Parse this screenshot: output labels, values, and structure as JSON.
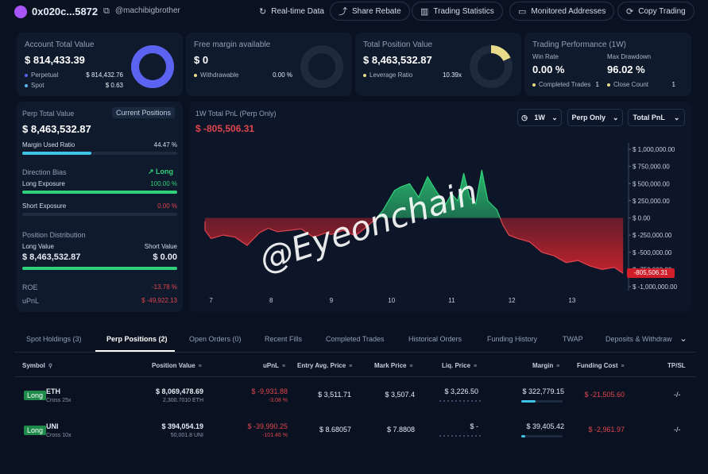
{
  "header": {
    "address": "0x020c...5872",
    "handle": "@machibigbrother",
    "buttons": [
      {
        "label": "Real-time Data",
        "icon": "refresh-icon"
      },
      {
        "label": "Share Rebate",
        "icon": "share-icon"
      },
      {
        "label": "Trading Statistics",
        "icon": "bar-chart-icon"
      },
      {
        "label": "Monitored Addresses",
        "icon": "monitor-icon"
      },
      {
        "label": "Copy Trading",
        "icon": "copy-trade-icon"
      }
    ]
  },
  "account": {
    "title": "Account Total Value",
    "value": "$ 814,433.39",
    "perpetual_label": "Perpetual",
    "perpetual_value": "$ 814,432.76",
    "spot_label": "Spot",
    "spot_value": "$ 0.63",
    "donut_fill": 0.999,
    "color": "#5b63f0"
  },
  "margin": {
    "title": "Free margin available",
    "value": "$ 0",
    "withdrawable_label": "Withdrawable",
    "withdrawable_value": "0.00 %"
  },
  "position": {
    "title": "Total Position Value",
    "value": "$ 8,463,532.87",
    "leverage_label": "Leverage Ratio",
    "leverage_value": "10.39x",
    "donut_fill": 0.18,
    "color": "#e8dc8a"
  },
  "performance": {
    "title": "Trading Performance (1W)",
    "win_rate_label": "Win Rate",
    "win_rate_value": "0.00 %",
    "drawdown_label": "Max Drawdown",
    "drawdown_value": "96.02 %",
    "completed_label": "Completed Trades",
    "completed_value": "1",
    "close_label": "Close Count",
    "close_value": "1"
  },
  "perp": {
    "title": "Perp Total Value",
    "current_positions": "Current Positions",
    "value": "$ 8,463,532.87",
    "margin_label": "Margin Used Ratio",
    "margin_value": "44.47 %",
    "margin_fill": 0.4447,
    "direction_label": "Direction Bias",
    "direction_value": "Long",
    "long_label": "Long Exposure",
    "long_value": "100.00 %",
    "long_fill": 1.0,
    "short_label": "Short Exposure",
    "short_value": "0.00 %",
    "short_fill": 0,
    "distribution_label": "Position Distribution",
    "long_value_label": "Long Value",
    "short_value_label": "Short Value",
    "long_value_amount": "$ 8,463,532.87",
    "short_value_amount": "$ 0.00",
    "roe_label": "ROE",
    "roe_value": "-13.78 %",
    "upnl_label": "uPnL",
    "upnl_value": "$ -49,922.13"
  },
  "pnl_chart": {
    "title": "1W Total PnL (Perp Only)",
    "value": "$ -805,506.31",
    "controls": [
      "1W",
      "Perp Only",
      "Total PnL"
    ],
    "watermark": "@Eyeonchain",
    "current_label": "-805,506.31"
  },
  "chart_data": {
    "type": "area",
    "title": "1W Total PnL (Perp Only)",
    "x_ticks": [
      "7",
      "8",
      "9",
      "10",
      "11",
      "12",
      "13"
    ],
    "y_ticks": [
      "$ 1,000,000.00",
      "$ 750,000.00",
      "$ 500,000.00",
      "$ 250,000.00",
      "$ 0.00",
      "$ -250,000.00",
      "$ -500,000.00",
      "$ -750,000.00",
      "$ -1,000,000.00"
    ],
    "ylim": [
      -1000000,
      1000000
    ],
    "xlim": [
      6.9,
      13.9
    ],
    "x": [
      6.7,
      6.8,
      6.9,
      7.0,
      7.2,
      7.4,
      7.6,
      7.8,
      7.95,
      8.1,
      8.3,
      8.5,
      8.7,
      8.9,
      9.0,
      9.2,
      9.4,
      9.6,
      9.75,
      9.85,
      9.95,
      10.05,
      10.15,
      10.3,
      10.45,
      10.6,
      10.75,
      10.9,
      11.0,
      11.1,
      11.2,
      11.3,
      11.4,
      11.5,
      11.6,
      11.75,
      11.85,
      11.95,
      12.1,
      12.3,
      12.5,
      12.7,
      12.9,
      13.1,
      13.3,
      13.5,
      13.7,
      13.85
    ],
    "values": [
      -50000,
      -120000,
      -180000,
      -300000,
      -250000,
      -280000,
      -400000,
      -220000,
      -150000,
      -200000,
      -180000,
      -160000,
      -280000,
      -220000,
      -240000,
      -180000,
      -260000,
      -120000,
      0,
      100000,
      250000,
      400000,
      450000,
      500000,
      300000,
      600000,
      380000,
      200000,
      350000,
      250000,
      650000,
      300000,
      200000,
      700000,
      250000,
      120000,
      -100000,
      -250000,
      -300000,
      -350000,
      -500000,
      -550000,
      -650000,
      -620000,
      -700000,
      -750000,
      -720000,
      -805506
    ]
  },
  "tabs": [
    "Spot Holdings (3)",
    "Perp Positions (2)",
    "Open Orders (0)",
    "Recent Fills",
    "Completed Trades",
    "Historical Orders",
    "Funding History",
    "TWAP",
    "Deposits & Withdraw"
  ],
  "table": {
    "headers": [
      "Symbol",
      "Position Value",
      "uPnL",
      "Entry Avg. Price",
      "Mark Price",
      "Liq. Price",
      "Margin",
      "Funding Cost",
      "TP/SL"
    ],
    "rows": [
      {
        "side": "Long",
        "symbol": "ETH",
        "leverage": "Cross 25x",
        "value": "$ 8,069,478.69",
        "size": "2,300.7010 ETH",
        "upnl": "$ -9,931.88",
        "upnl_pct": "-3.08 %",
        "entry": "$ 3,511.71",
        "mark": "$ 3,507.4",
        "liq": "$ 3,226.50",
        "margin": "$ 322,779.15",
        "margin_fill": 0.35,
        "funding": "$ -21,505.60",
        "tpsl": "-/-"
      },
      {
        "side": "Long",
        "symbol": "UNI",
        "leverage": "Cross 10x",
        "value": "$ 394,054.19",
        "size": "50,001.8 UNI",
        "upnl": "$ -39,990.25",
        "upnl_pct": "-101.46 %",
        "entry": "$ 8.68057",
        "mark": "$ 7.8808",
        "liq": "$ -",
        "margin": "$ 39,405.42",
        "margin_fill": 0.1,
        "funding": "$ -2,961.97",
        "tpsl": "-/-"
      }
    ]
  }
}
